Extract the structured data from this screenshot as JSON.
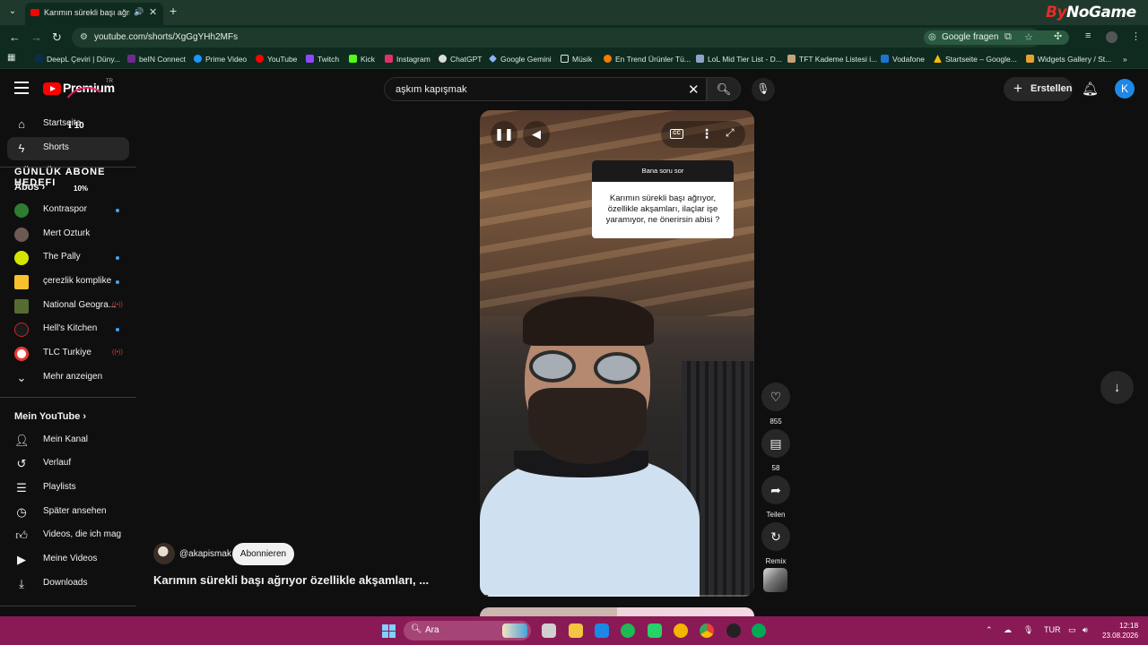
{
  "browser": {
    "tab_title": "Karımın sürekli başı ağrıyor",
    "url": "youtube.com/shorts/XgGgYHh2MFs",
    "google_search_label": "Google fragen",
    "bookmarks": [
      "DeepL Çeviri | Düny...",
      "beIN Connect",
      "Prime Video",
      "YouTube",
      "Twitch",
      "Kick",
      "Instagram",
      "ChatGPT",
      "Google Gemini",
      "Müsik",
      "En Trend Ürünler Tü...",
      "LoL Mid Tier List - D...",
      "TFT Kademe Listesi i...",
      "Vodafone",
      "Startseite – Google...",
      "Widgets Gallery / St..."
    ]
  },
  "watermark": {
    "part1": "By",
    "part2": "NoGame"
  },
  "masthead": {
    "logo_text": "Premium",
    "country_code": "TR",
    "search_query": "aşkım kapışmak",
    "create_label": "Erstellen",
    "avatar_letter": "K"
  },
  "overlay": {
    "goal_title": "GÜNLÜK ABONE HEDEFI",
    "count": "10",
    "percent": "10%"
  },
  "sidebar": {
    "home": "Startseite",
    "shorts": "Shorts",
    "subs_heading": "Abos",
    "channels": [
      {
        "name": "Kontraspor",
        "status": "new"
      },
      {
        "name": "Mert Ozturk",
        "status": ""
      },
      {
        "name": "The Pally",
        "status": "new"
      },
      {
        "name": "çerezlik komplike",
        "status": "new"
      },
      {
        "name": "National Geogra...",
        "status": "live"
      },
      {
        "name": "Hell's Kitchen",
        "status": "new"
      },
      {
        "name": "TLC Turkiye",
        "status": "live"
      }
    ],
    "show_more": "Mehr anzeigen",
    "my_youtube_heading": "Mein YouTube",
    "my_items": [
      "Mein Kanal",
      "Verlauf",
      "Playlists",
      "Später ansehen",
      "Videos, die ich mag",
      "Meine Videos",
      "Downloads"
    ]
  },
  "player": {
    "question_header": "Bana soru sor",
    "question_text": "Karımın sürekli başı ağrıyor, özellikle akşamları, ilaçlar işe yaramıyor, ne önerirsin abisi ?",
    "cc_label": "CC",
    "progress": 0.03
  },
  "actions": {
    "like_count": "855",
    "comment_count": "58",
    "share_label": "Teilen",
    "remix_label": "Remix"
  },
  "video": {
    "channel_handle": "@akapismak",
    "subscribe_label": "Abonnieren",
    "title": "Karımın sürekli başı ağrıyor özellikle akşamları, ..."
  },
  "taskbar": {
    "search_placeholder": "Ara",
    "language": "TUR",
    "time": "12:18",
    "date": "23.08.2026"
  },
  "colors": {
    "youtube_red": "#ff0000",
    "chrome_frame": "#0f2b20",
    "taskbar": "#8a1a55",
    "subscription_dot": "#3ea6ff"
  }
}
